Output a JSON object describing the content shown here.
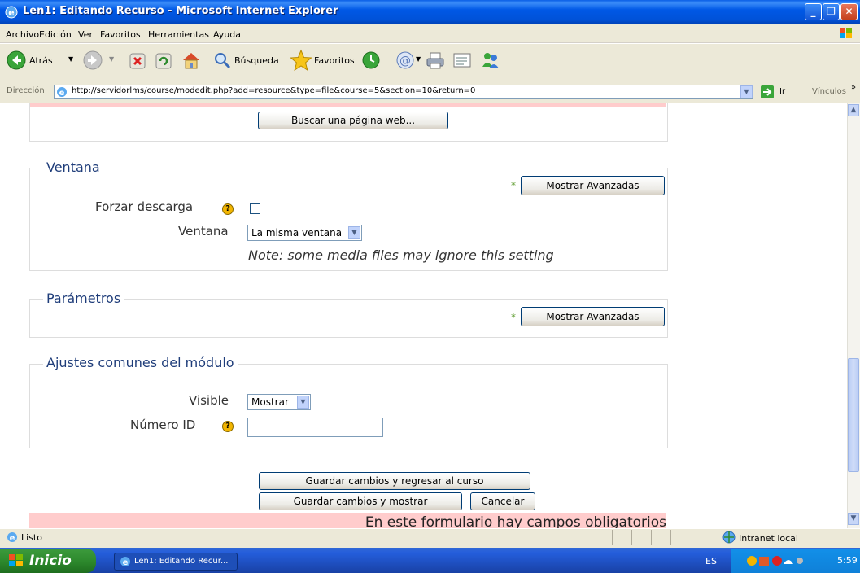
{
  "window": {
    "title": "Len1: Editando Recurso - Microsoft Internet Explorer"
  },
  "menu": [
    "Archivo",
    "Edición",
    "Ver",
    "Favoritos",
    "Herramientas",
    "Ayuda"
  ],
  "toolbar": {
    "back": "Atrás",
    "search": "Búsqueda",
    "favorites": "Favoritos"
  },
  "address": {
    "label": "Dirección",
    "url": "http://servidorlms/course/modedit.php?add=resource&type=file&course=5&section=10&return=0",
    "go": "Ir",
    "links": "Vínculos"
  },
  "content": {
    "search_web_button": "Buscar una página web...",
    "ventana": {
      "legend": "Ventana",
      "advanced_button": "Mostrar Avanzadas",
      "force_download_label": "Forzar descarga",
      "window_label": "Ventana",
      "window_value": "La misma ventana",
      "note": "Note: some media files may ignore this setting"
    },
    "parametros": {
      "legend": "Parámetros",
      "advanced_button": "Mostrar Avanzadas"
    },
    "ajustes": {
      "legend": "Ajustes comunes del módulo",
      "visible_label": "Visible",
      "visible_value": "Mostrar",
      "id_label": "Número ID",
      "id_value": ""
    },
    "save_return_button": "Guardar cambios y regresar al curso",
    "save_show_button": "Guardar cambios y mostrar",
    "cancel_button": "Cancelar",
    "required_notice": "En este formulario hay campos obligatorios"
  },
  "status": {
    "text": "Listo",
    "zone": "Intranet local"
  },
  "taskbar": {
    "start": "Inicio",
    "task": "Len1: Editando Recur...",
    "lang": "ES",
    "time": "5:59"
  },
  "colors": {
    "legend": "#1F3D7A",
    "required_bg": "#FFCCCC",
    "titlebar": "#0054E3"
  }
}
